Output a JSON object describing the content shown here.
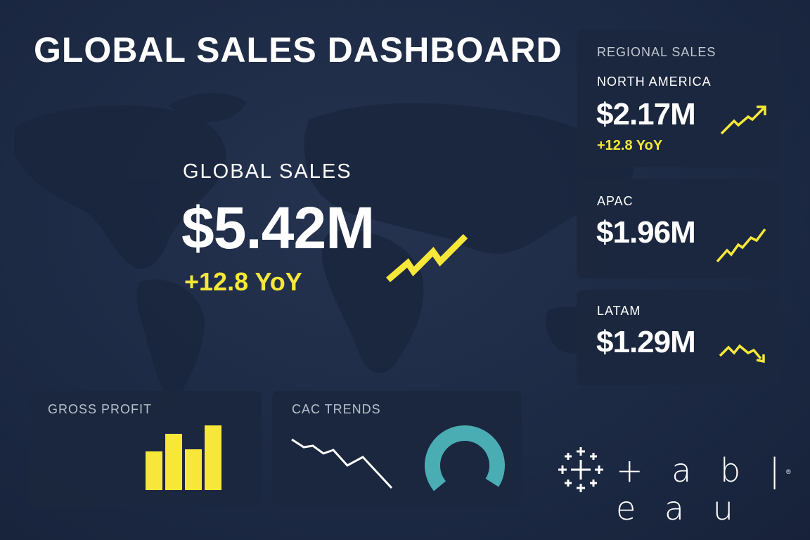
{
  "header": {
    "title": "GLOBAL SALES DASHBOARD"
  },
  "colors": {
    "background": "#1d2a44",
    "card": "#1c273e",
    "accent_yellow": "#f6e739",
    "accent_teal": "#4aadb3"
  },
  "global": {
    "label": "GLOBAL SALES",
    "value": "$5.42M",
    "change": "+12.8 YoY",
    "trend": "up"
  },
  "regional": {
    "title": "REGIONAL SALES",
    "items": [
      {
        "name": "NORTH AMERICA",
        "value": "$2.17M",
        "change": "+12.8 YoY",
        "trend": "up"
      },
      {
        "name": "APAC",
        "value": "$1.96M",
        "trend": "up"
      },
      {
        "name": "LATAM",
        "value": "$1.29M",
        "trend": "down"
      }
    ]
  },
  "gross_profit": {
    "title": "GROSS PROFIT",
    "bars": [
      0.55,
      0.8,
      0.58,
      0.92
    ]
  },
  "cac_trends": {
    "title": "CAC TRENDS",
    "gauge_fraction": 0.7
  },
  "logo": {
    "text": "+ a b | e a u",
    "brand": "tableau",
    "registered": "®"
  }
}
